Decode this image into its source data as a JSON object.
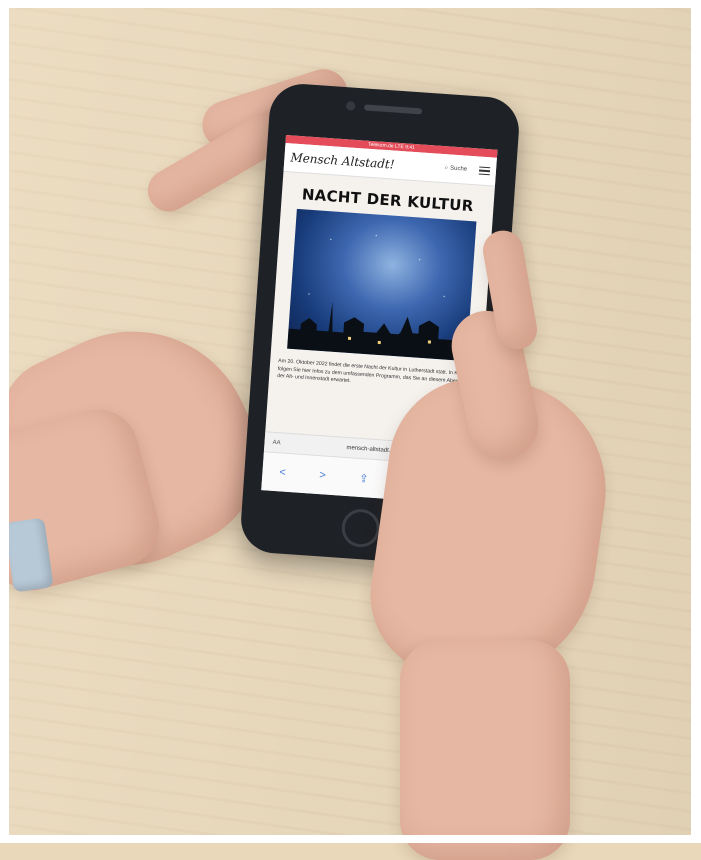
{
  "status_bar": {
    "text": "Telekom.de LTE    9:41"
  },
  "site": {
    "logo": "Mensch Altstadt!",
    "search_label": "Suche",
    "title": "NACHT DER KULTUR",
    "body": "Am 20. Oktober 2022 findet die erste Nacht der Kultur in Lutherstadt statt. In Kürze folgen Sie hier Infos zu dem umfassenden Programm, das Sie an diesem Abend in der Alt- und Innenstadt erwartet."
  },
  "browser": {
    "aa_label": "AA",
    "url": "mensch-altstadt.de",
    "reload_icon": "↻",
    "toolbar": [
      "<",
      ">",
      "⇪",
      "📖",
      "⧉"
    ]
  },
  "colors": {
    "status_bar": "#e44c59",
    "table": "#ead9bb",
    "phone": "#1e2126",
    "sky": "#3d67b0"
  }
}
